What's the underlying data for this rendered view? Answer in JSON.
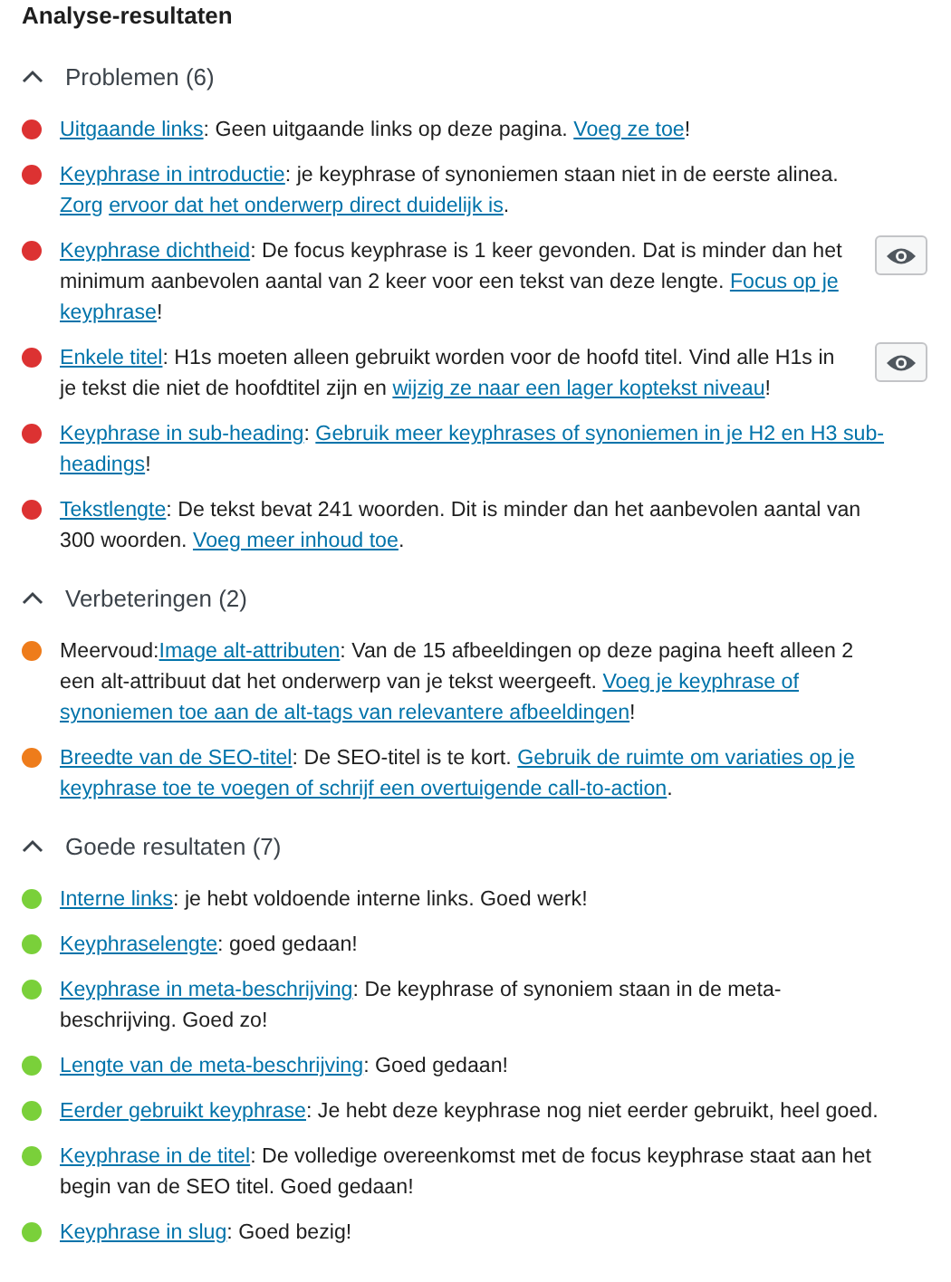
{
  "title": "Analyse-resultaten",
  "sections": [
    {
      "label": "Problemen (6)",
      "expanded": true,
      "items": [
        {
          "color": "#dc3232",
          "eye_button": false,
          "segments": [
            {
              "text": "Uitgaande links",
              "link": true
            },
            {
              "text": ": Geen uitgaande links op deze pagina. ",
              "link": false
            },
            {
              "text": "Voeg ze toe",
              "link": true
            },
            {
              "text": "!",
              "link": false
            }
          ]
        },
        {
          "color": "#dc3232",
          "eye_button": false,
          "segments": [
            {
              "text": "Keyphrase in introductie",
              "link": true
            },
            {
              "text": ": je keyphrase of synoniemen staan niet in de eerste alinea. ",
              "link": false
            },
            {
              "text": "Zorg",
              "link": true
            },
            {
              "text": "ervoor dat het onderwerp direct duidelijk is",
              "link": true
            },
            {
              "text": ".",
              "link": false
            }
          ]
        },
        {
          "color": "#dc3232",
          "eye_button": true,
          "segments": [
            {
              "text": "Keyphrase dichtheid",
              "link": true
            },
            {
              "text": ": De focus keyphrase is 1 keer gevonden. Dat is minder dan het minimum aanbevolen aantal van 2 keer voor een tekst van deze lengte. ",
              "link": false
            },
            {
              "text": "Focus op je",
              "link": true
            },
            {
              "text": "keyphrase",
              "link": true
            },
            {
              "text": "!",
              "link": false
            }
          ]
        },
        {
          "color": "#dc3232",
          "eye_button": true,
          "segments": [
            {
              "text": "Enkele titel",
              "link": true
            },
            {
              "text": ": H1s moeten alleen gebruikt worden voor de hoofd titel. Vind alle H1s in je tekst die niet de hoofdtitel zijn en ",
              "link": false
            },
            {
              "text": "wijzig ze naar een lager koptekst niveau",
              "link": true
            },
            {
              "text": "!",
              "link": false
            }
          ]
        },
        {
          "color": "#dc3232",
          "eye_button": false,
          "segments": [
            {
              "text": "Keyphrase in sub-heading",
              "link": true
            },
            {
              "text": ": ",
              "link": false
            },
            {
              "text": "Gebruik meer keyphrases of synoniemen in je H2 en H3 sub-",
              "link": true
            },
            {
              "text": "headings",
              "link": true
            },
            {
              "text": "!",
              "link": false
            }
          ]
        },
        {
          "color": "#dc3232",
          "eye_button": false,
          "segments": [
            {
              "text": "Tekstlengte",
              "link": true
            },
            {
              "text": ": De tekst bevat 241 woorden. Dit is minder dan het aanbevolen aantal van 300 woorden. ",
              "link": false
            },
            {
              "text": "Voeg meer inhoud toe",
              "link": true
            },
            {
              "text": ".",
              "link": false
            }
          ]
        }
      ]
    },
    {
      "label": "Verbeteringen (2)",
      "expanded": true,
      "items": [
        {
          "color": "#ee7c1b",
          "eye_button": false,
          "segments": [
            {
              "text": "Meervoud:",
              "link": false
            },
            {
              "text": "Image alt-attributen",
              "link": true
            },
            {
              "text": ": Van de 15 afbeeldingen op deze pagina heeft alleen 2 een alt-attribuut dat het onderwerp van je tekst weergeeft. ",
              "link": false
            },
            {
              "text": "Voeg je keyphrase of",
              "link": true
            },
            {
              "text": "synoniemen toe aan de alt-tags van relevantere afbeeldingen",
              "link": true
            },
            {
              "text": "!",
              "link": false
            }
          ]
        },
        {
          "color": "#ee7c1b",
          "eye_button": false,
          "segments": [
            {
              "text": "Breedte van de SEO-titel",
              "link": true
            },
            {
              "text": ": De SEO-titel is te kort. ",
              "link": false
            },
            {
              "text": "Gebruik de ruimte om variaties op je",
              "link": true
            },
            {
              "text": "keyphrase toe te voegen of schrijf een overtuigende call-to-action",
              "link": true
            },
            {
              "text": ".",
              "link": false
            }
          ]
        }
      ]
    },
    {
      "label": "Goede resultaten (7)",
      "expanded": true,
      "items": [
        {
          "color": "#7ad03a",
          "eye_button": false,
          "segments": [
            {
              "text": "Interne links",
              "link": true
            },
            {
              "text": ": je hebt voldoende interne links. Goed werk!",
              "link": false
            }
          ]
        },
        {
          "color": "#7ad03a",
          "eye_button": false,
          "segments": [
            {
              "text": "Keyphraselengte",
              "link": true
            },
            {
              "text": ": goed gedaan!",
              "link": false
            }
          ]
        },
        {
          "color": "#7ad03a",
          "eye_button": false,
          "segments": [
            {
              "text": "Keyphrase in meta-beschrijving",
              "link": true
            },
            {
              "text": ": De keyphrase of synoniem staan in de meta-beschrijving. Goed zo!",
              "link": false
            }
          ]
        },
        {
          "color": "#7ad03a",
          "eye_button": false,
          "segments": [
            {
              "text": "Lengte van de meta-beschrijving",
              "link": true
            },
            {
              "text": ": Goed gedaan!",
              "link": false
            }
          ]
        },
        {
          "color": "#7ad03a",
          "eye_button": false,
          "segments": [
            {
              "text": "Eerder gebruikt keyphrase",
              "link": true
            },
            {
              "text": ": Je hebt deze keyphrase nog niet eerder gebruikt, heel goed.",
              "link": false
            }
          ]
        },
        {
          "color": "#7ad03a",
          "eye_button": false,
          "segments": [
            {
              "text": "Keyphrase in de titel",
              "link": true
            },
            {
              "text": ": De volledige overeenkomst met de focus keyphrase staat aan het begin van de SEO titel. Goed gedaan!",
              "link": false
            }
          ]
        },
        {
          "color": "#7ad03a",
          "eye_button": false,
          "segments": [
            {
              "text": "Keyphrase in slug",
              "link": true
            },
            {
              "text": ": Goed bezig!",
              "link": false
            }
          ]
        }
      ]
    }
  ]
}
